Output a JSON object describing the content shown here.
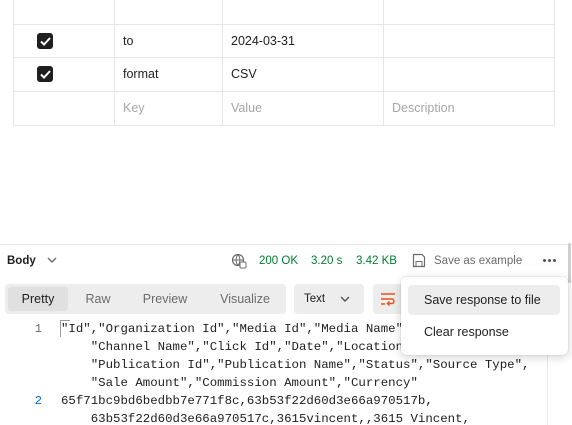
{
  "params": {
    "rows": [
      {
        "key": "to",
        "value": "2024-03-31",
        "checked": true
      },
      {
        "key": "format",
        "value": "CSV",
        "checked": true
      }
    ],
    "placeholder": {
      "key": "Key",
      "value": "Value",
      "description": "Description"
    }
  },
  "response": {
    "body_label": "Body",
    "status": "200 OK",
    "time": "3.20 s",
    "size": "3.42 KB",
    "save_example": "Save as example",
    "status_color": "#007f31"
  },
  "view_tabs": [
    {
      "label": "Pretty",
      "active": true
    },
    {
      "label": "Raw",
      "active": false
    },
    {
      "label": "Preview",
      "active": false
    },
    {
      "label": "Visualize",
      "active": false
    }
  ],
  "format_select": "Text",
  "code": {
    "lines": [
      {
        "num": "1",
        "text": "\"Id\",\"Organization Id\",\"Media Id\",\"Media Name\","
      },
      {
        "num": "",
        "text": "    \"Channel Name\",\"Click Id\",\"Date\",\"Location\""
      },
      {
        "num": "",
        "text": "    \"Publication Id\",\"Publication Name\",\"Status\",\"Source Type\","
      },
      {
        "num": "",
        "text": "    \"Sale Amount\",\"Commission Amount\",\"Currency\""
      },
      {
        "num": "2",
        "text": "65f71bc9bd6bedbb7e771f8c,63b53f22d60d3e66a970517b,"
      },
      {
        "num": "",
        "text": "    63b53f22d60d3e66a970517c,3615vincent,,3615 Vincent,"
      }
    ]
  },
  "context_menu": {
    "items": [
      {
        "label": "Save response to file",
        "highlighted": true
      },
      {
        "label": "Clear response",
        "highlighted": false
      }
    ]
  },
  "colors": {
    "accent": "#e8521a",
    "ok": "#007f31",
    "line_number_active": "#0b67c9"
  }
}
